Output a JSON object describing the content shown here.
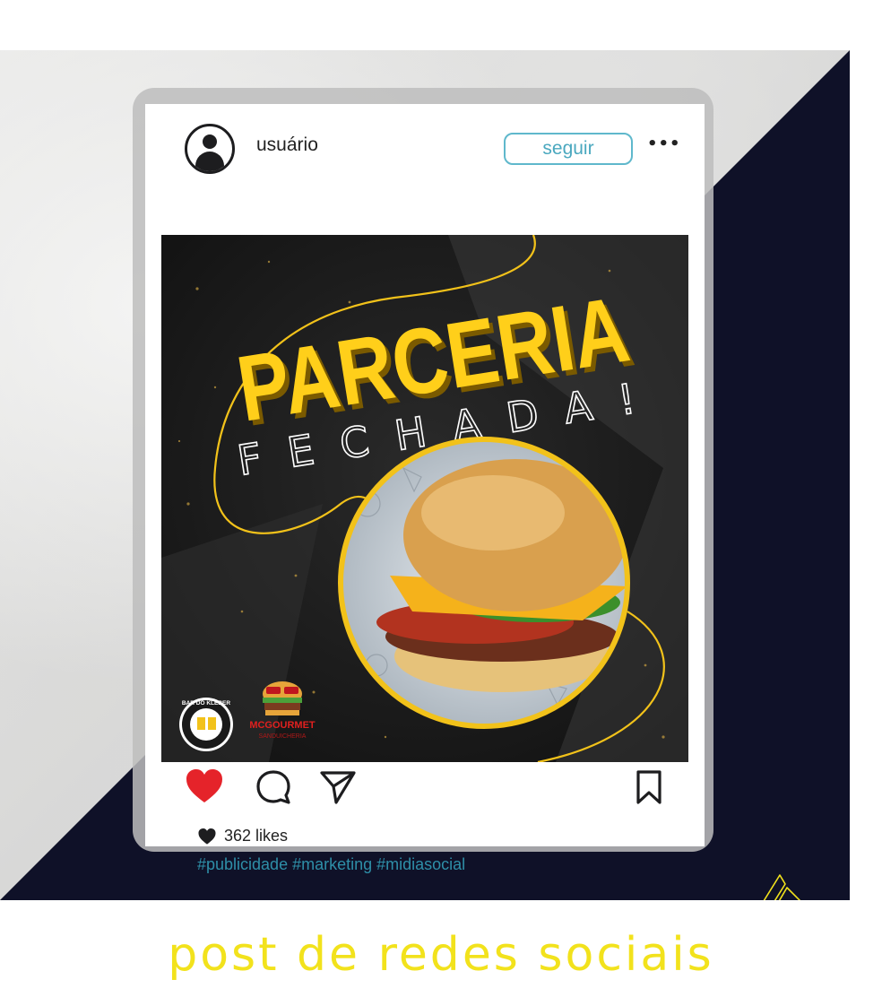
{
  "post": {
    "username": "usuário",
    "follow_label": "seguir",
    "more_label": "•••",
    "likes_text": "362 likes",
    "hashtags": "#publicidade #marketing #midiasocial",
    "liked": true
  },
  "artwork": {
    "headline": "PARCERIA",
    "subheadline": "FECHADA!",
    "logo_left_text": "BAR DO KLEBER",
    "logo_right_top": "MCGOURMET",
    "logo_right_bottom": "SANDUICHERIA"
  },
  "caption": "post de redes sociais",
  "colors": {
    "accent_yellow": "#f2e21c",
    "navy": "#0f1128",
    "like_red": "#e5232a",
    "follow_border": "#5fb8cc",
    "hashtag": "#2e8fa8",
    "artwork_yellow": "#ffcf1a"
  },
  "icons": [
    "user-avatar-icon",
    "more-dots-icon",
    "heart-icon",
    "comment-icon",
    "send-icon",
    "bookmark-icon",
    "small-heart-icon",
    "brand-logo-icon"
  ]
}
